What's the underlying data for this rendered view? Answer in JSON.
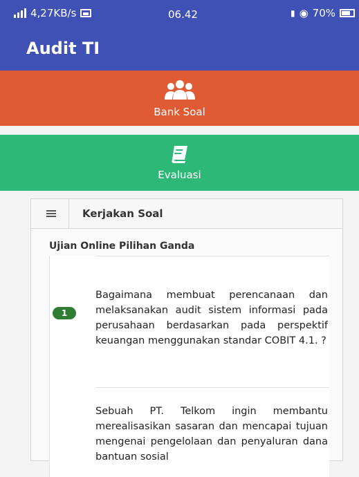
{
  "status_bar": {
    "network_speed": "4,27KB/s",
    "time": "06.42",
    "battery": "70%"
  },
  "app_bar": {
    "title": "Audit TI"
  },
  "menu": {
    "bank_soal": {
      "label": "Bank Soal",
      "icon": "users-icon",
      "color": "#e05a34"
    },
    "evaluasi": {
      "label": "Evaluasi",
      "icon": "book-icon",
      "color": "#2db877"
    }
  },
  "panel": {
    "header_label": "Kerjakan Soal",
    "subtitle": "Ujian Online Pilihan Ganda",
    "questions": [
      {
        "number": "1",
        "text": "Bagaimana membuat perencanaan dan melaksanakan audit sistem informasi pada perusahaan berdasarkan pada perspektif keuangan menggunakan standar COBIT 4.1. ?"
      },
      {
        "number": "",
        "text": "Sebuah PT. Telkom ingin membantu merealisasikan sasaran dan mencapai tujuan mengenai pengelolaan dan penyaluran dana bantuan sosial"
      }
    ]
  },
  "colors": {
    "primary": "#3f51b5",
    "badge": "#2f7d32"
  }
}
